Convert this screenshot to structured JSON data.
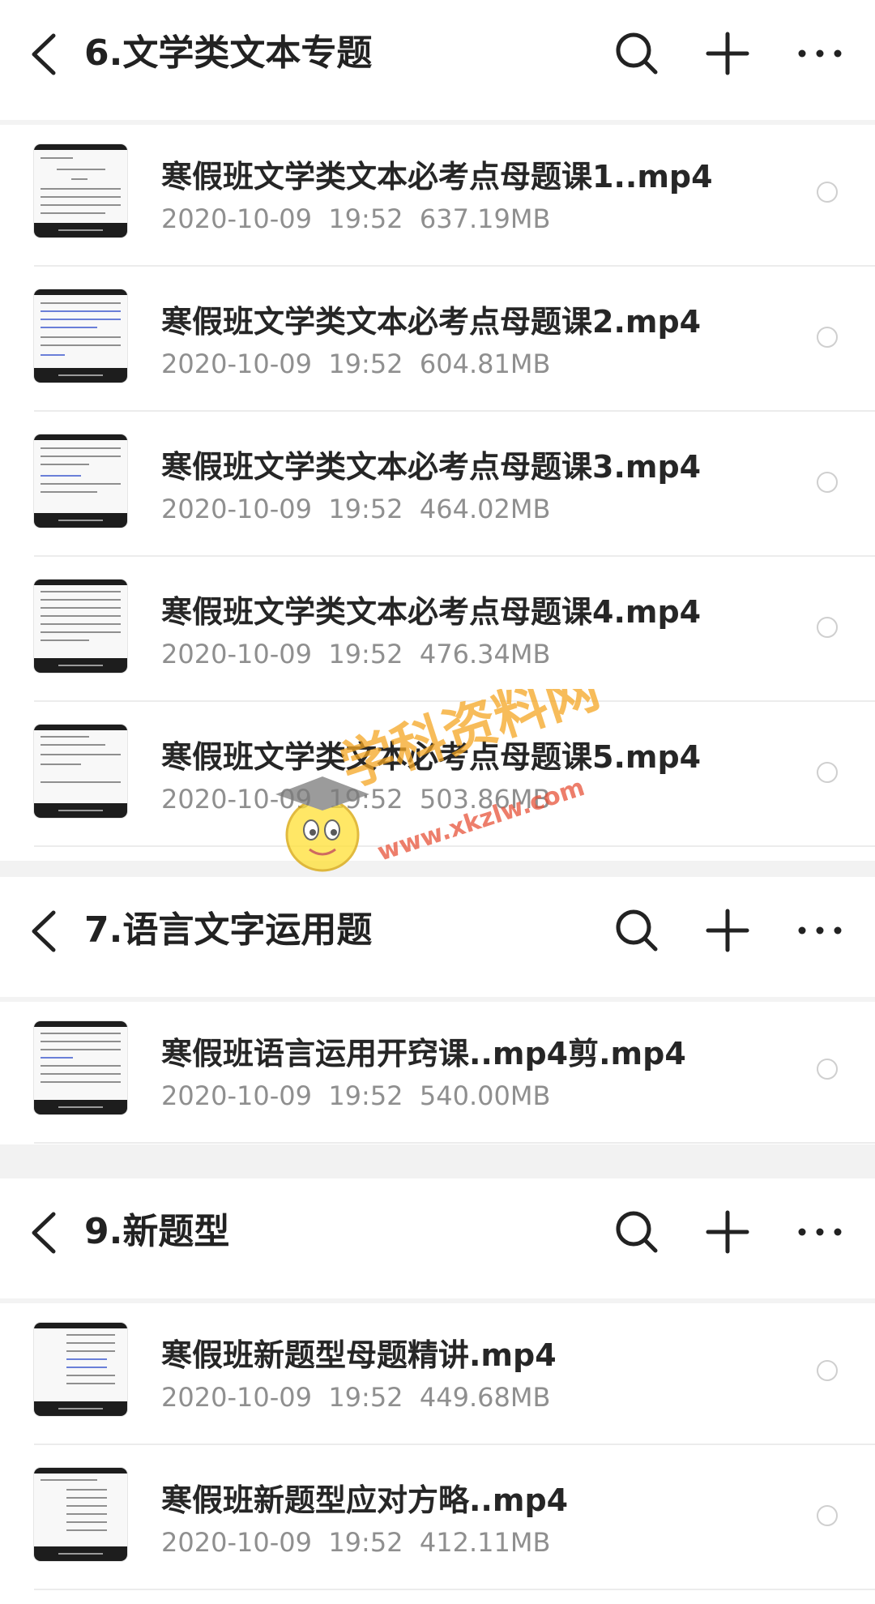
{
  "sections": [
    {
      "title": "6.文学类文本专题",
      "files": [
        {
          "name": "寒假班文学类文本必考点母题课1..mp4",
          "date": "2020-10-09",
          "time": "19:52",
          "size": "637.19MB"
        },
        {
          "name": "寒假班文学类文本必考点母题课2.mp4",
          "date": "2020-10-09",
          "time": "19:52",
          "size": "604.81MB"
        },
        {
          "name": "寒假班文学类文本必考点母题课3.mp4",
          "date": "2020-10-09",
          "time": "19:52",
          "size": "464.02MB"
        },
        {
          "name": "寒假班文学类文本必考点母题课4.mp4",
          "date": "2020-10-09",
          "time": "19:52",
          "size": "476.34MB"
        },
        {
          "name": "寒假班文学类文本必考点母题课5.mp4",
          "date": "2020-10-09",
          "time": "19:52",
          "size": "503.86MB"
        }
      ]
    },
    {
      "title": "7.语言文字运用题",
      "files": [
        {
          "name": "寒假班语言运用开窍课..mp4剪.mp4",
          "date": "2020-10-09",
          "time": "19:52",
          "size": "540.00MB"
        }
      ]
    },
    {
      "title": "9.新题型",
      "files": [
        {
          "name": "寒假班新题型母题精讲.mp4",
          "date": "2020-10-09",
          "time": "19:52",
          "size": "449.68MB"
        },
        {
          "name": "寒假班新题型应对方略..mp4",
          "date": "2020-10-09",
          "time": "19:52",
          "size": "412.11MB"
        }
      ]
    }
  ],
  "icons": {
    "back": "chevron-left-icon",
    "search": "search-icon",
    "add": "plus-icon",
    "more": "more-dots-icon",
    "select": "radio-circle-icon"
  },
  "watermark": {
    "brand": "学科资料网",
    "domain": "www.xkzlw.com"
  },
  "colors": {
    "title_text": "#222222",
    "meta_text": "#8f8f8f",
    "background": "#f2f2f2",
    "watermark_orange": "#f5a623",
    "watermark_green": "#7ed321",
    "watermark_red": "#e8543a"
  }
}
